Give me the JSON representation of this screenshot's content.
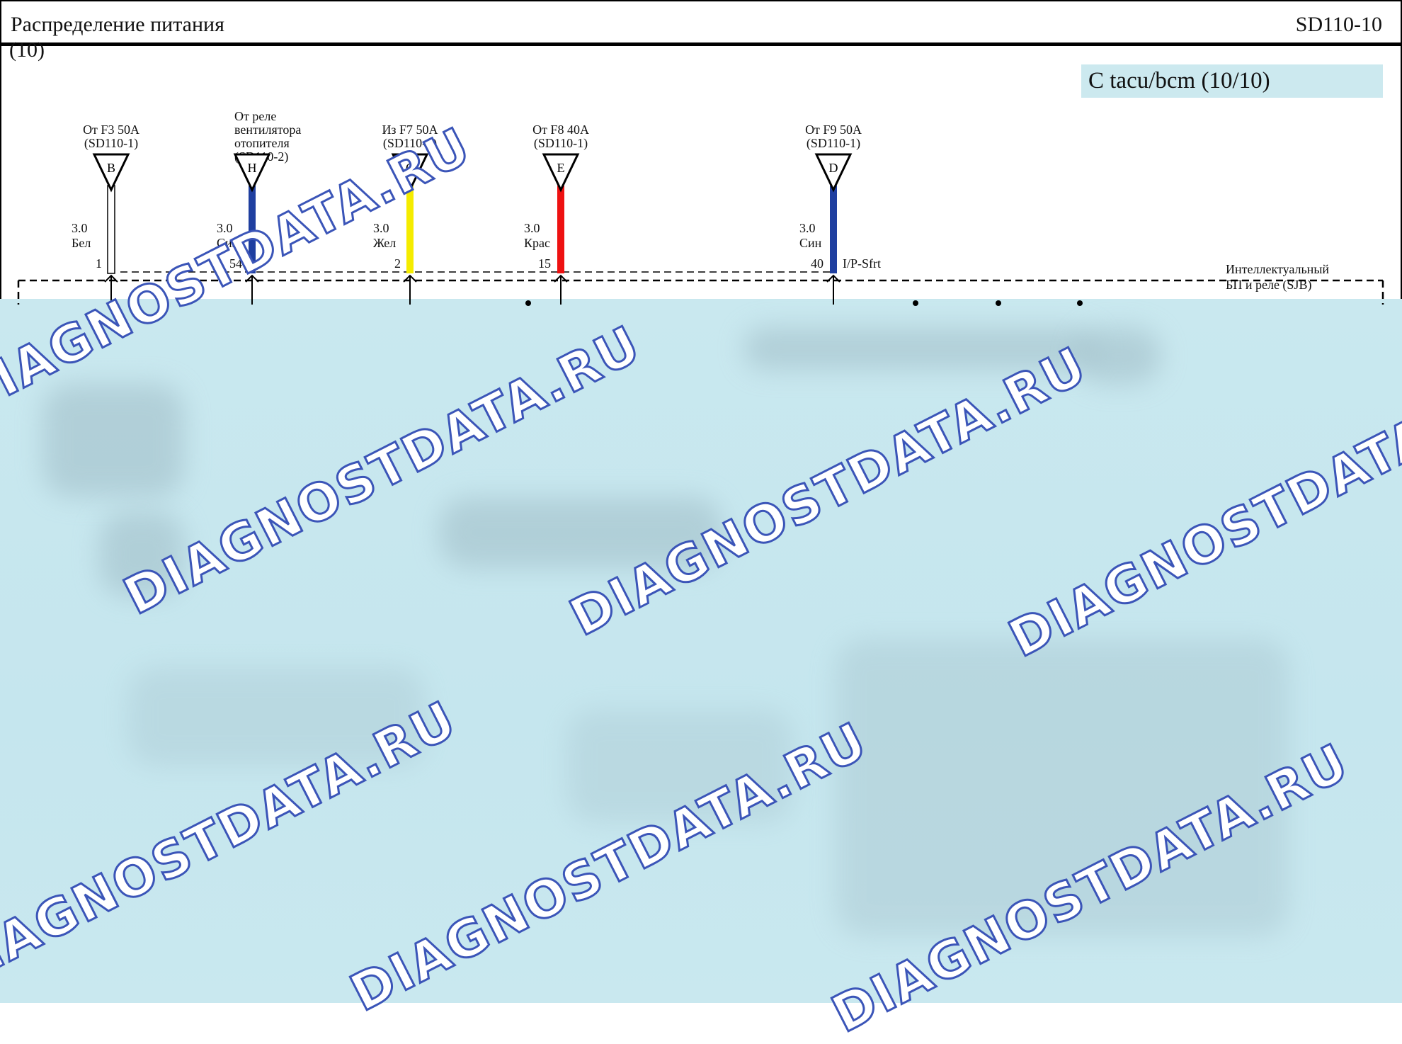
{
  "header": {
    "title": "Распределение питания",
    "subtitle": "(10)",
    "code": "SD110-10"
  },
  "section_label": "С tacu/bcm (10/10)",
  "connectors": [
    {
      "id": "B",
      "source_lines": [
        "От F3 50A",
        "(SD110-1)"
      ],
      "gauge": "3.0",
      "color_name": "Бел",
      "pin": "1",
      "wire_color": "#ffffff"
    },
    {
      "id": "H",
      "source_lines": [
        "От реле",
        "вентилятора",
        "отопителя",
        "(SD110-2)"
      ],
      "gauge": "3.0",
      "color_name": "Син",
      "pin": "54",
      "wire_color": "#1f3fa0"
    },
    {
      "id": "C",
      "source_lines": [
        "Из F7 50A",
        "(SD110-1)"
      ],
      "gauge": "3.0",
      "color_name": "Жел",
      "pin": "2",
      "wire_color": "#f5ec00"
    },
    {
      "id": "E",
      "source_lines": [
        "От F8 40A",
        "(SD110-1)"
      ],
      "gauge": "3.0",
      "color_name": "Крас",
      "pin": "15",
      "wire_color": "#ee1111"
    },
    {
      "id": "D",
      "source_lines": [
        "От F9 50A",
        "(SD110-1)"
      ],
      "gauge": "3.0",
      "color_name": "Син",
      "pin": "40",
      "wire_color": "#1f3fa0"
    }
  ],
  "connector_tag": "I/P-Sfrt",
  "module_label_lines": [
    "Интеллектуальный",
    "БП и реле (SJB)"
  ],
  "watermark": "DIAGNOSTDATA.RU",
  "colors": {
    "section_fill": "#cce9ef",
    "blur_fill": "#c9e8ef",
    "watermark_stroke": "#3b55b8"
  }
}
